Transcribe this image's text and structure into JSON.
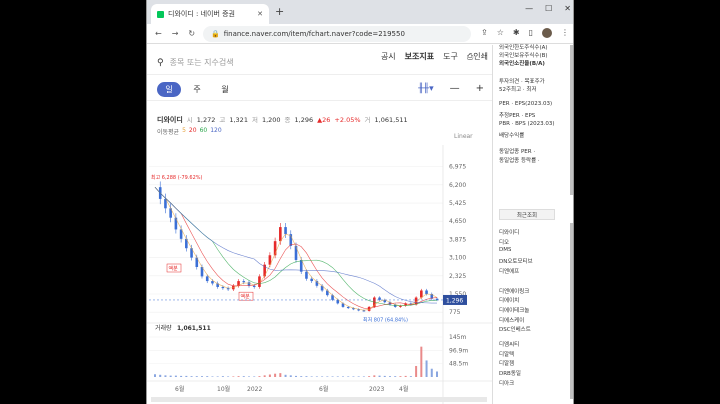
{
  "browser": {
    "tab_title": "디와이디 : 네이버 증권",
    "url": "finance.naver.com/item/fchart.naver?code=219550"
  },
  "search": {
    "placeholder": "종목 또는 지수검색"
  },
  "top_menu": [
    "공시",
    "보조지표",
    "도구",
    "인쇄"
  ],
  "periods": [
    "일",
    "주",
    "월"
  ],
  "quote": {
    "name": "디와이디",
    "open_label": "시",
    "open": "1,272",
    "high_label": "고",
    "high": "1,321",
    "low_label": "저",
    "low": "1,200",
    "close_label": "종",
    "close": "1,296",
    "change": "▲26",
    "change_pct": "+2.05%",
    "volume_label": "거",
    "volume": "1,061,511"
  },
  "moving_average": {
    "label": "이동평균",
    "values": [
      "5",
      "20",
      "60",
      "120"
    ]
  },
  "scale_mode": "Linear",
  "chart_data": {
    "type": "line",
    "y_ticks": [
      "6,975",
      "6,200",
      "5,425",
      "4,650",
      "3,875",
      "3,100",
      "2,325",
      "1,550",
      "775"
    ],
    "ylim": [
      400,
      7300
    ],
    "x_ticks": [
      "6월",
      "10월",
      "2022",
      "6월",
      "2023",
      "4월"
    ],
    "current_price": "1,296",
    "max_annotation": "최고 6,288 (-79.62%)",
    "min_annotation": "최저 807 (64.84%)",
    "event_labels": [
      "액분",
      "액분"
    ],
    "series": [
      {
        "name": "종",
        "color": "#e62a2a",
        "values": [
          6100,
          5600,
          5200,
          4800,
          4300,
          3900,
          3500,
          3100,
          2700,
          2300,
          2100,
          2000,
          1850,
          1800,
          1750,
          1900,
          2100,
          2050,
          1900,
          1850,
          2300,
          2800,
          3200,
          3800,
          4400,
          4100,
          3600,
          3000,
          2500,
          2200,
          2100,
          1900,
          1700,
          1500,
          1300,
          1150,
          1000,
          950,
          900,
          850,
          830,
          1000,
          1400,
          1300,
          1200,
          1100,
          1000,
          1050,
          1150,
          1100,
          1400,
          1700,
          1550,
          1350,
          1296
        ]
      }
    ],
    "volume_label": "거래량",
    "volume_value": "1,061,511",
    "volume_ticks": [
      "145m",
      "96.9m",
      "48.5m"
    ],
    "volume_values": [
      10,
      8,
      6,
      5,
      5,
      4,
      4,
      3,
      3,
      3,
      3,
      2,
      2,
      3,
      2,
      2,
      3,
      3,
      2,
      2,
      3,
      6,
      9,
      12,
      14,
      8,
      6,
      4,
      3,
      3,
      2,
      2,
      2,
      2,
      2,
      2,
      2,
      2,
      2,
      2,
      2,
      3,
      6,
      5,
      4,
      3,
      3,
      3,
      4,
      3,
      40,
      110,
      60,
      30,
      20
    ]
  },
  "sidebar": {
    "foreign_ratio_labels": [
      "외국인한도주식수(A)",
      "외국인보유주식수(B)",
      "외국인소진율(B/A)"
    ],
    "opinion_labels": [
      "투자의견 · 목표주가",
      "52주최고 · 최저"
    ],
    "per_labels": [
      "PER · EPS(2023.03)",
      "추정PER · EPS",
      "PBR · BPS (2023.03)",
      "배당수익률"
    ],
    "industry_labels": [
      "동일업종 PER ·",
      "동일업종 등락률 ·"
    ],
    "recent_header": "최근조회",
    "recent_items": [
      "디와이디",
      "디오",
      "DMS",
      "DN오토모티브",
      "디엔에프",
      "디엔에이링크",
      "디에이치",
      "디에이테크놀",
      "디에스케이",
      "DSC인베스트",
      "디엠씨티",
      "디알텍",
      "디알젬",
      "DRB동일",
      "디아크"
    ]
  }
}
